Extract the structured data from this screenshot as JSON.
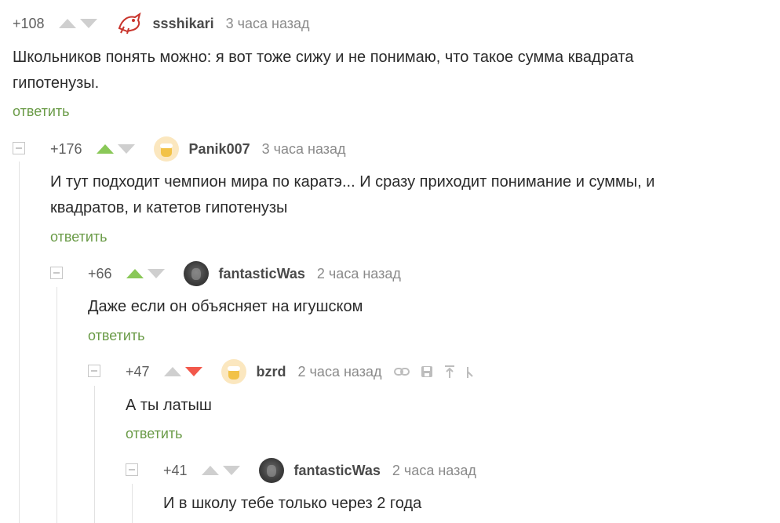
{
  "comments": [
    {
      "rating": "+108",
      "vote": "none",
      "username": "ssshikari",
      "time": "3 часа назад",
      "text": [
        "Школьников понять можно: я вот тоже сижу и не понимаю, что такое сумма квадрата",
        "гипотенузы."
      ],
      "reply": "ответить",
      "avatar_icon": "red-bird-avatar-icon"
    },
    {
      "rating": "+176",
      "vote": "up",
      "username": "Panik007",
      "time": "3 часа назад",
      "text": [
        "И тут подходит чемпион мира по каратэ... И сразу приходит понимание и суммы, и",
        "квадратов, и катетов гипотенузы"
      ],
      "reply": "ответить",
      "avatar_icon": "beer-mug-avatar-icon"
    },
    {
      "rating": "+66",
      "vote": "up",
      "username": "fantasticWas",
      "time": "2 часа назад",
      "text": [
        "Даже если он объясняет на игушском"
      ],
      "reply": "ответить",
      "avatar_icon": "photo-avatar-icon"
    },
    {
      "rating": "+47",
      "vote": "down",
      "username": "bzrd",
      "time": "2 часа назад",
      "text": [
        "А ты латыш"
      ],
      "reply": "ответить",
      "avatar_icon": "beer-mug-avatar-icon",
      "toolbar_icons": [
        "link-icon",
        "save-icon",
        "scroll-up-icon",
        "more-icon"
      ]
    },
    {
      "rating": "+41",
      "vote": "none",
      "username": "fantasticWas",
      "time": "2 часа назад",
      "text": [
        "И в школу тебе только через 2 года"
      ],
      "reply": "",
      "avatar_icon": "photo-avatar-icon"
    }
  ],
  "colors": {
    "upvote_active": "#8ac858",
    "downvote_active": "#f2584b",
    "reply_link": "#6a9b47",
    "arrow_inactive": "#cfcfcf"
  }
}
